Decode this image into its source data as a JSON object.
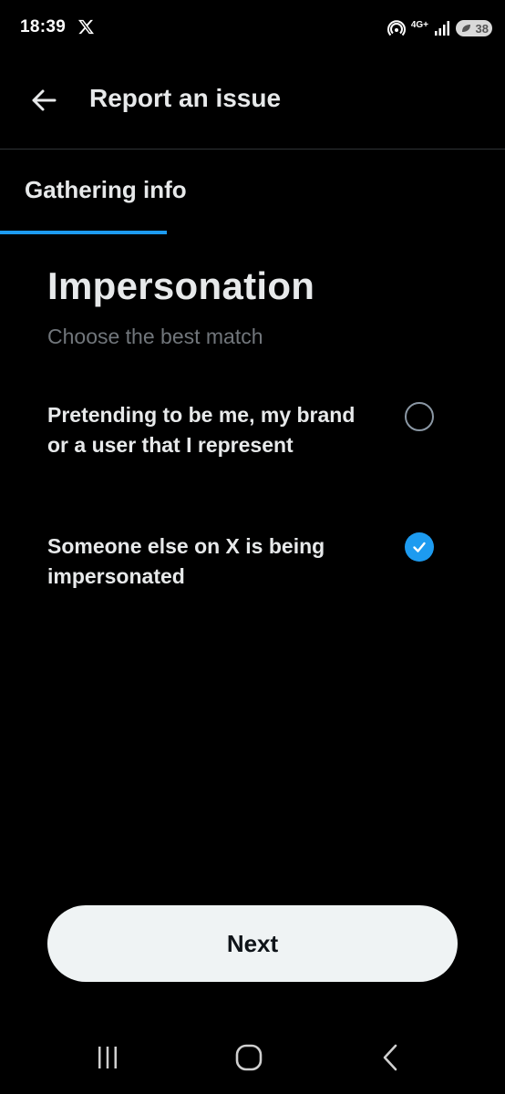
{
  "status_bar": {
    "time": "18:39",
    "network": "4G+",
    "battery_level": "38"
  },
  "header": {
    "title": "Report an issue"
  },
  "tab": {
    "label": "Gathering info"
  },
  "main": {
    "title": "Impersonation",
    "subtitle": "Choose the best match",
    "options": [
      {
        "label": "Pretending to be me, my brand or a user that I represent",
        "selected": false
      },
      {
        "label": "Someone else on X is being impersonated",
        "selected": true
      }
    ]
  },
  "footer": {
    "next_label": "Next"
  },
  "nav_bar": {
    "icons": [
      "recent-apps-icon",
      "home-icon",
      "back-icon"
    ]
  },
  "colors": {
    "background": "#000000",
    "accent": "#1d9bf0",
    "text_primary": "#e7e9ea",
    "text_secondary": "#71767b",
    "button_bg": "#eff3f4",
    "divider": "#2f3336"
  }
}
